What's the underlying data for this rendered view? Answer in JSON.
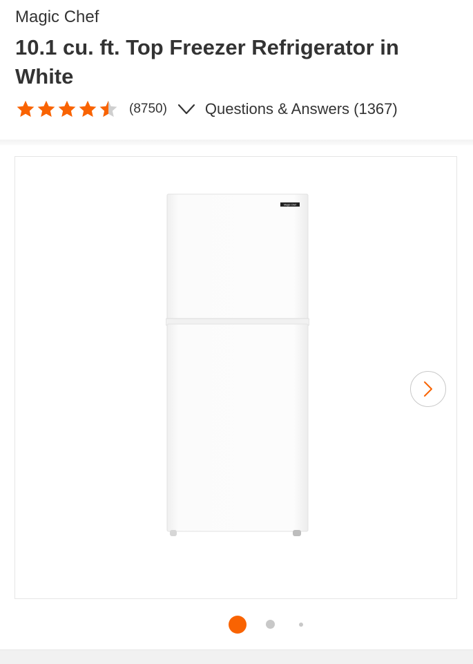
{
  "product": {
    "brand": "Magic Chef",
    "title": "10.1 cu. ft. Top Freezer Refrigerator in White",
    "rating": 4.5,
    "rating_max": 5,
    "review_count_text": "(8750)",
    "qa_text": "Questions & Answers (1367)",
    "fridge_badge_text": "Magic Chef"
  },
  "carousel": {
    "current_index": 1,
    "total_dots": 3,
    "next_icon": "chevron-right-icon"
  },
  "colors": {
    "accent": "#f96302",
    "star_empty": "#cfcfcf",
    "text": "#333333"
  }
}
